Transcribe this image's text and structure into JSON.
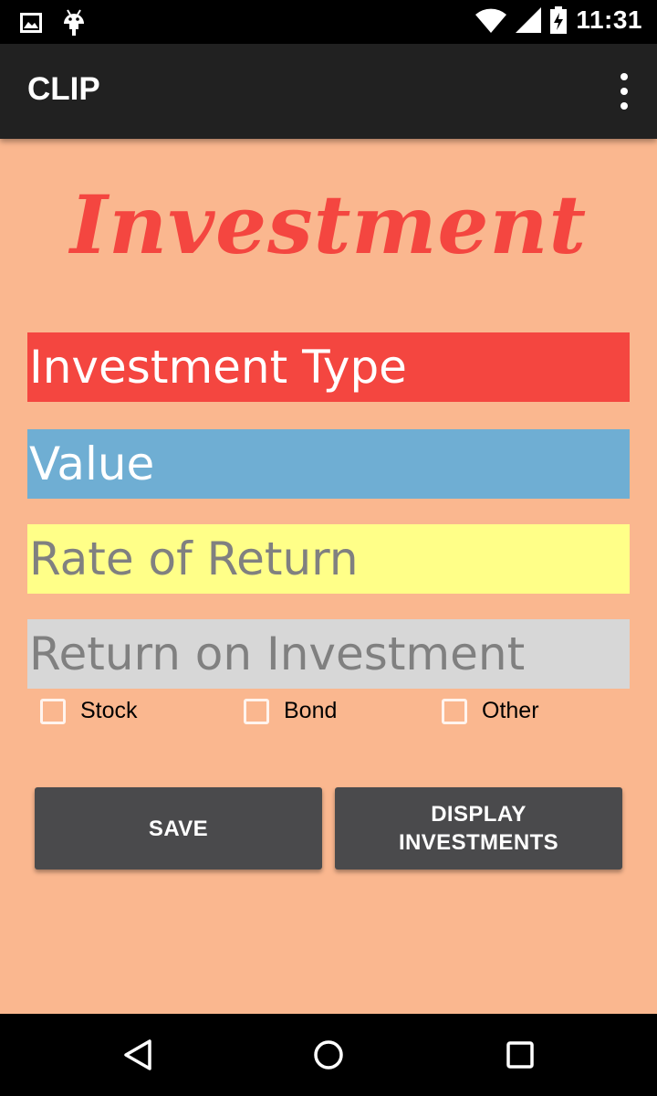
{
  "status_bar": {
    "time": "11:31",
    "icons": [
      "image-notification-icon",
      "android-debug-icon",
      "wifi-icon",
      "cell-signal-icon",
      "battery-charging-icon"
    ]
  },
  "app_bar": {
    "title": "CLIP",
    "menu_icon": "overflow-menu-icon"
  },
  "main": {
    "heading": "Investment",
    "fields": {
      "investment_type": {
        "placeholder": "Investment Type",
        "value": ""
      },
      "value": {
        "placeholder": "Value",
        "value": ""
      },
      "rate_of_return": {
        "placeholder": "Rate of Return",
        "value": ""
      },
      "return_on_investment": {
        "placeholder": "Return on Investment",
        "value": ""
      }
    },
    "checkboxes": {
      "stock": {
        "label": "Stock",
        "checked": false
      },
      "bond": {
        "label": "Bond",
        "checked": false
      },
      "other": {
        "label": "Other",
        "checked": false
      }
    },
    "buttons": {
      "save": "SAVE",
      "display": "DISPLAY\nINVESTMENTS"
    }
  },
  "nav_bar": {
    "icons": [
      "back-icon",
      "home-icon",
      "recents-icon"
    ]
  },
  "colors": {
    "background": "#fab78f",
    "heading": "#f44640",
    "type_field": "#f44640",
    "value_field": "#6faed3",
    "rate_field": "#ffff88",
    "roi_field": "#d7d7d7",
    "button": "#4a4a4c",
    "app_bar": "#212121"
  }
}
